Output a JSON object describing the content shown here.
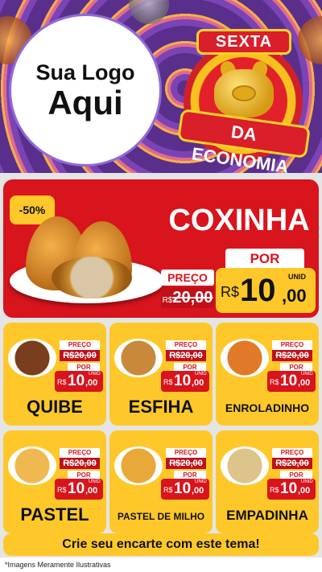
{
  "header": {
    "logo_line1": "Sua Logo",
    "logo_line2": "Aqui",
    "badge_top": "SEXTA",
    "badge_bottom": "DA ECONOMIA"
  },
  "featured": {
    "discount": "-50%",
    "name": "COXINHA",
    "price_label": "PREÇO",
    "old_currency": "R$",
    "old_price": "20,00",
    "por_label": "POR",
    "new_currency": "R$",
    "new_int": "10",
    "new_dec": ",00",
    "unit": "UNID"
  },
  "products": [
    {
      "name": "QUIBE",
      "price_label": "PREÇO",
      "old_price": "R$20,00",
      "por_label": "POR",
      "currency": "R$",
      "int": "10",
      "dec": ",00",
      "unit": "UNID",
      "image_color": "#7a3d1d"
    },
    {
      "name": "ESFIHA",
      "price_label": "PREÇO",
      "old_price": "R$20,00",
      "por_label": "POR",
      "currency": "R$",
      "int": "10",
      "dec": ",00",
      "unit": "UNID",
      "image_color": "#c88a3a"
    },
    {
      "name": "ENROLADINHO",
      "price_label": "PREÇO",
      "old_price": "R$20,00",
      "por_label": "POR",
      "currency": "R$",
      "int": "10",
      "dec": ",00",
      "unit": "UNID",
      "image_color": "#e07a28"
    },
    {
      "name": "PASTEL",
      "price_label": "PREÇO",
      "old_price": "R$20,00",
      "por_label": "POR",
      "currency": "R$",
      "int": "10",
      "dec": ",00",
      "unit": "UNID",
      "image_color": "#f0b850"
    },
    {
      "name": "PASTEL DE MILHO",
      "price_label": "PREÇO",
      "old_price": "R$20,00",
      "por_label": "POR",
      "currency": "R$",
      "int": "10",
      "dec": ",00",
      "unit": "UNID",
      "image_color": "#e8a83a"
    },
    {
      "name": "EMPADINHA",
      "price_label": "PREÇO",
      "old_price": "R$20,00",
      "por_label": "POR",
      "currency": "R$",
      "int": "10",
      "dec": ",00",
      "unit": "UNID",
      "image_color": "#dcc48a"
    }
  ],
  "footer": {
    "cta": "Crie seu encarte com este tema!",
    "disclaimer": "*Imagens Meramente Ilustrativas"
  },
  "colors": {
    "red": "#d8141d",
    "yellow": "#ffc82a",
    "purple": "#5a2f8c"
  }
}
